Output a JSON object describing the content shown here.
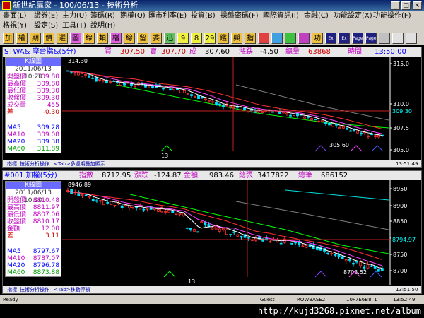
{
  "window": {
    "title": "新世紀贏家 - 100/06/13 - 技術分析"
  },
  "menu": {
    "row1": [
      "畫面(L)",
      "證券(E)",
      "主力(U)",
      "籌碼(R)",
      "期權(Q)",
      "匯市利率(E)",
      "投資(B)",
      "操盤密碼(F)",
      "國際資訊(I)",
      "金融(C)",
      "功能設定(X)",
      "功能操作(F)"
    ],
    "row2": [
      "格視(Y)",
      "設定(S)",
      "工具(T)",
      "說明(H)"
    ]
  },
  "toolbar": [
    "加",
    "權",
    "期",
    "價",
    "選",
    "圖",
    "線",
    "類",
    "檔",
    "線",
    "留",
    "委",
    "迅",
    "9",
    "8",
    "29",
    "鑑",
    "興",
    "指",
    "",
    "",
    "",
    "",
    "功",
    "Ex",
    "Ex",
    "Page",
    "Page",
    "",
    "",
    ""
  ],
  "panels": [
    {
      "header": {
        "symbol": "STWA& 摩台指&(5分)",
        "buy_label": "買",
        "buy": "307.50",
        "sell_label": "賣",
        "sell": "307.70",
        "deal_label": "成",
        "deal": "307.60",
        "change_label": "漲跌",
        "change": "-4.50",
        "volume_label": "總量",
        "volume": "63868",
        "time_label": "時間",
        "time": "13:50:00"
      },
      "info": {
        "title": "K線圖",
        "date": "2011/06/13 10:20",
        "rows": [
          {
            "k": "開盤價",
            "v": "309.80",
            "color": "#c000c0"
          },
          {
            "k": "最高價",
            "v": "309.80",
            "color": "#c000c0"
          },
          {
            "k": "最低價",
            "v": "309.30",
            "color": "#c000c0"
          },
          {
            "k": "收盤價",
            "v": "309.30",
            "color": "#c000c0"
          },
          {
            "k": "成交量",
            "v": "455",
            "color": "#c000c0"
          },
          {
            "k": "差",
            "v": "-0.30",
            "color": "#d00000"
          }
        ],
        "ma": [
          {
            "k": "MA5",
            "v": "309.28",
            "color": "#0000ff"
          },
          {
            "k": "MA10",
            "v": "309.08",
            "color": "#c000c0"
          },
          {
            "k": "MA20",
            "v": "309.38",
            "color": "#0000ff"
          },
          {
            "k": "MA60",
            "v": "311.89",
            "color": "#00a000"
          }
        ]
      },
      "chart": {
        "ticks": [
          "315.0",
          "310.0",
          "307.5",
          "305.0"
        ],
        "cursor_price": "309.30",
        "high_label": "314.30",
        "low_label": "305.60",
        "x_label": "13"
      },
      "subtools": [
        "指標",
        "技術分析操作",
        "<Tab>多週期疊加顯示"
      ],
      "subtime": "13:51:49"
    },
    {
      "header": {
        "symbol": "#001 加權(5分)",
        "index_label": "指數",
        "index": "8712.95",
        "change_label": "漲跌",
        "change": "-124.87",
        "amount_label": "金額",
        "amount": "983.46",
        "volume_label": "總張",
        "volume": "3417822",
        "count_label": "總筆",
        "count": "686152"
      },
      "info": {
        "title": "K線圖",
        "date": "2011/06/13 10:20",
        "rows": [
          {
            "k": "開盤價",
            "v": "8810.48",
            "color": "#c000c0"
          },
          {
            "k": "最高價",
            "v": "8811.97",
            "color": "#c000c0"
          },
          {
            "k": "最低價",
            "v": "8807.06",
            "color": "#c000c0"
          },
          {
            "k": "收盤價",
            "v": "8810.17",
            "color": "#c000c0"
          },
          {
            "k": "金額",
            "v": "12.00",
            "color": "#c000c0"
          },
          {
            "k": "差",
            "v": "3.11",
            "color": "#d00000"
          }
        ],
        "ma": [
          {
            "k": "MA5",
            "v": "8797.67",
            "color": "#0000ff"
          },
          {
            "k": "MA10",
            "v": "8787.07",
            "color": "#c000c0"
          },
          {
            "k": "MA20",
            "v": "8796.78",
            "color": "#0000ff"
          },
          {
            "k": "MA60",
            "v": "8873.88",
            "color": "#00a000"
          }
        ]
      },
      "chart": {
        "ticks": [
          "8950",
          "8900",
          "8850",
          "8800",
          "8750",
          "8700"
        ],
        "cursor_price": "8794.97",
        "high_label": "8946.89",
        "low_label": "8703.52",
        "x_label": "13"
      },
      "subtools": [
        "指標",
        "技術分析操作",
        "<Tab>移動停損"
      ],
      "subtime": "13:51:50"
    }
  ],
  "status": {
    "left": "Ready",
    "user": "Guest",
    "server": "ROWBASE2",
    "code": "10F7E6B8_1",
    "time": "13:52:49"
  },
  "watermark": "http://kujd3268.pixnet.net/album",
  "colors": {
    "up": "#ff3030",
    "down": "#00e0ff",
    "ma5": "#ffffff",
    "ma10": "#ff40ff",
    "ma20": "#ff3030",
    "ma60": "#00ff00",
    "long": "#808080",
    "cursor": "#c02020"
  }
}
